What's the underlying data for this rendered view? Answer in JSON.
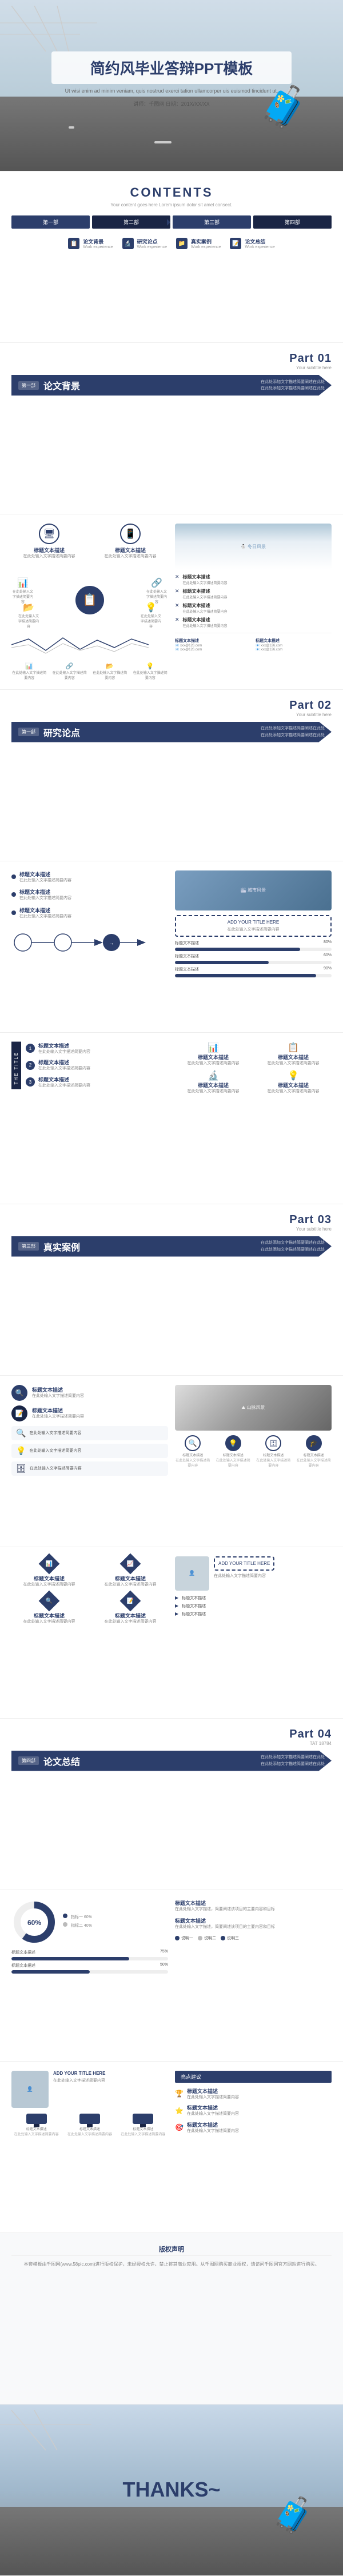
{
  "cover": {
    "main_title": "简约风毕业答辩PPT模板",
    "subtitle": "Ut wisi enim ad minim veniam, quis nostrud exerci tation ullamcorper uis euismod tincidunt ut.",
    "meta": "讲师：千图网  日期：201X/XX/XX"
  },
  "contents": {
    "title": "CONTENTS",
    "subtitle": "Your content goes here Lorem ipsum dolor sit amet consect.",
    "tabs": [
      "第一部",
      "第二部",
      "第三部",
      "第四部"
    ],
    "items": [
      {
        "icon": "📋",
        "label": "论文背景",
        "sub": "Work experience"
      },
      {
        "icon": "🔬",
        "label": "研究论点",
        "sub": "Work experience"
      },
      {
        "icon": "📁",
        "label": "真实案例",
        "sub": "Work experience"
      },
      {
        "icon": "📝",
        "label": "论文总结",
        "sub": "Work experience"
      }
    ]
  },
  "part01": {
    "label": "Part 01",
    "sub_label": "Your subtitle here",
    "banner_num": "第一部",
    "banner_title": "论文背景",
    "desc_lines": [
      "在此处添加文字描述简要阐述在此处",
      "在此处添加文字描述简要阐述在此处"
    ]
  },
  "part02": {
    "label": "Part 02",
    "sub_label": "Your subtitle here",
    "banner_num": "第一部",
    "banner_title": "研究论点",
    "desc_lines": [
      "在此处添加文字描述简要阐述在此处",
      "在此处添加文字描述简要阐述在此处"
    ]
  },
  "part03": {
    "label": "Part 03",
    "sub_label": "Your subtitle here",
    "banner_num": "第三部",
    "banner_title": "真实案例",
    "desc_lines": [
      "在此处添加文字描述简要阐述在此处",
      "在此处添加文字描述简要阐述在此处"
    ]
  },
  "part04": {
    "label": "Part 04",
    "sub_label": "TAT 18784",
    "banner_num": "第四部",
    "banner_title": "论文总结",
    "desc_lines": [
      "在此处添加文字描述简要阐述在此处",
      "在此处添加文字描述简要阐述在此处"
    ]
  },
  "generic_text": {
    "title": "标题文本描述",
    "body": "在此处输入文字描述，简要阐述该项目的主要内容和目标",
    "body_short": "在此处输入文字描述简要内容",
    "add_title": "ADD YOUR TITLE HERE",
    "the_title": "THE TITLE"
  },
  "thanks": {
    "text": "THANKS~"
  },
  "copyright": {
    "title": "版权声明",
    "body": "本套模板由千图网(www.58pic.com)进行版权保护，未经授权允许，禁止将其商业应用。从千图网购买商业授权，请访问千图网官方网站进行购买。"
  }
}
